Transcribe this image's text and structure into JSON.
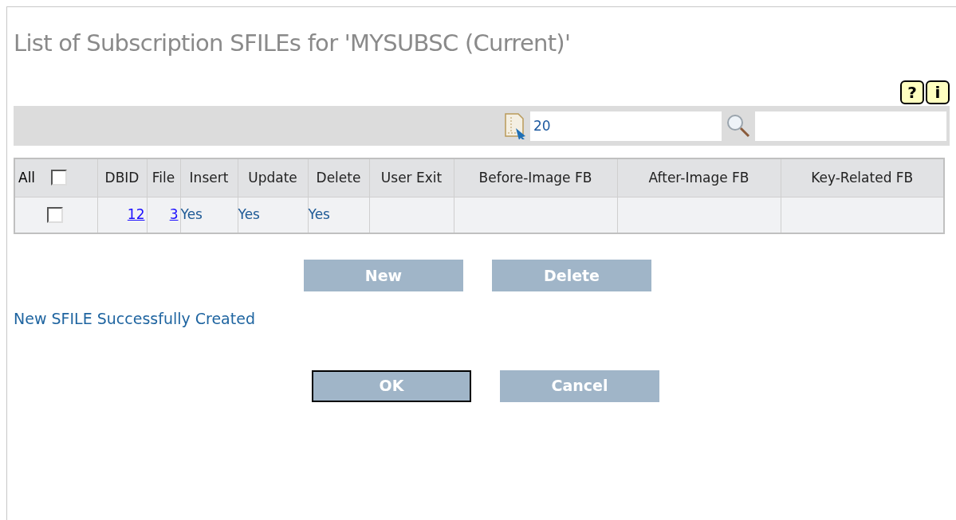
{
  "title": "List of Subscription SFILEs for 'MYSUBSC (Current)'",
  "help_buttons": [
    "?",
    "i"
  ],
  "toolbar": {
    "page_size": "20"
  },
  "table": {
    "select_all": {
      "label": "All",
      "checked": false
    },
    "columns": [
      "DBID",
      "File",
      "Insert",
      "Update",
      "Delete",
      "User Exit",
      "Before-Image FB",
      "After-Image FB",
      "Key-Related FB"
    ],
    "rows": [
      {
        "checked": false,
        "dbid": "12",
        "file": "3",
        "insert": "Yes",
        "update": "Yes",
        "delete": "Yes"
      }
    ]
  },
  "table_buttons": [
    {
      "label": "New",
      "focused": false
    },
    {
      "label": "Delete",
      "focused": false
    }
  ],
  "message": "New SFILE Successfully Created",
  "dialog_buttons": [
    {
      "label": "OK",
      "focused": true
    },
    {
      "label": "Cancel",
      "focused": false
    }
  ]
}
